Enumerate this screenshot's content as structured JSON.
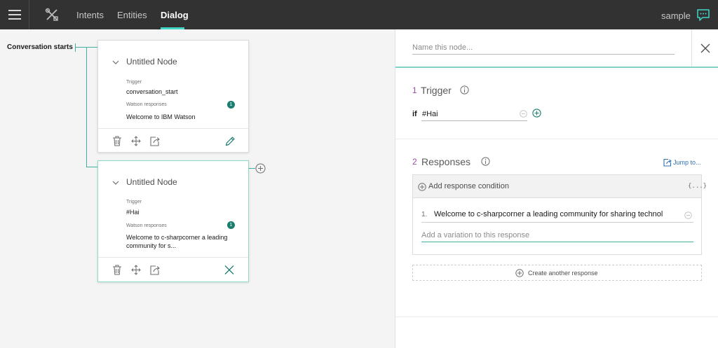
{
  "topbar": {
    "tabs": [
      {
        "label": "Intents"
      },
      {
        "label": "Entities"
      },
      {
        "label": "Dialog"
      }
    ],
    "workspace": "sample"
  },
  "canvas": {
    "conversation_label": "Conversation starts",
    "nodes": [
      {
        "title": "Untitled Node",
        "trigger_label": "Trigger",
        "trigger": "conversation_start",
        "responses_label": "Watson responses",
        "response_count": "1",
        "response_preview": "Welcome to IBM Watson"
      },
      {
        "title": "Untitled Node",
        "trigger_label": "Trigger",
        "trigger": "#Hai",
        "responses_label": "Watson responses",
        "response_count": "1",
        "response_preview_line1": "Welcome to c-sharpcorner a leading",
        "response_preview_line2": "community for s..."
      }
    ]
  },
  "panel": {
    "name_placeholder": "Name this node...",
    "trigger": {
      "number": "1",
      "title": "Trigger",
      "if_label": "if",
      "condition": "#Hai"
    },
    "responses": {
      "number": "2",
      "title": "Responses",
      "jump_label": "Jump to...",
      "add_condition_label": "Add response condition",
      "code_label": "{...}",
      "items": [
        {
          "number": "1.",
          "text": "Welcome to c-sharpcorner a leading community for sharing technol"
        }
      ],
      "variation_placeholder": "Add a variation to this response",
      "create_label": "Create another response"
    }
  },
  "colors": {
    "accent": "#41d6c3",
    "badge": "#1b7e6e",
    "section_number": "#9b4aa6",
    "link": "#2d6fb3"
  }
}
